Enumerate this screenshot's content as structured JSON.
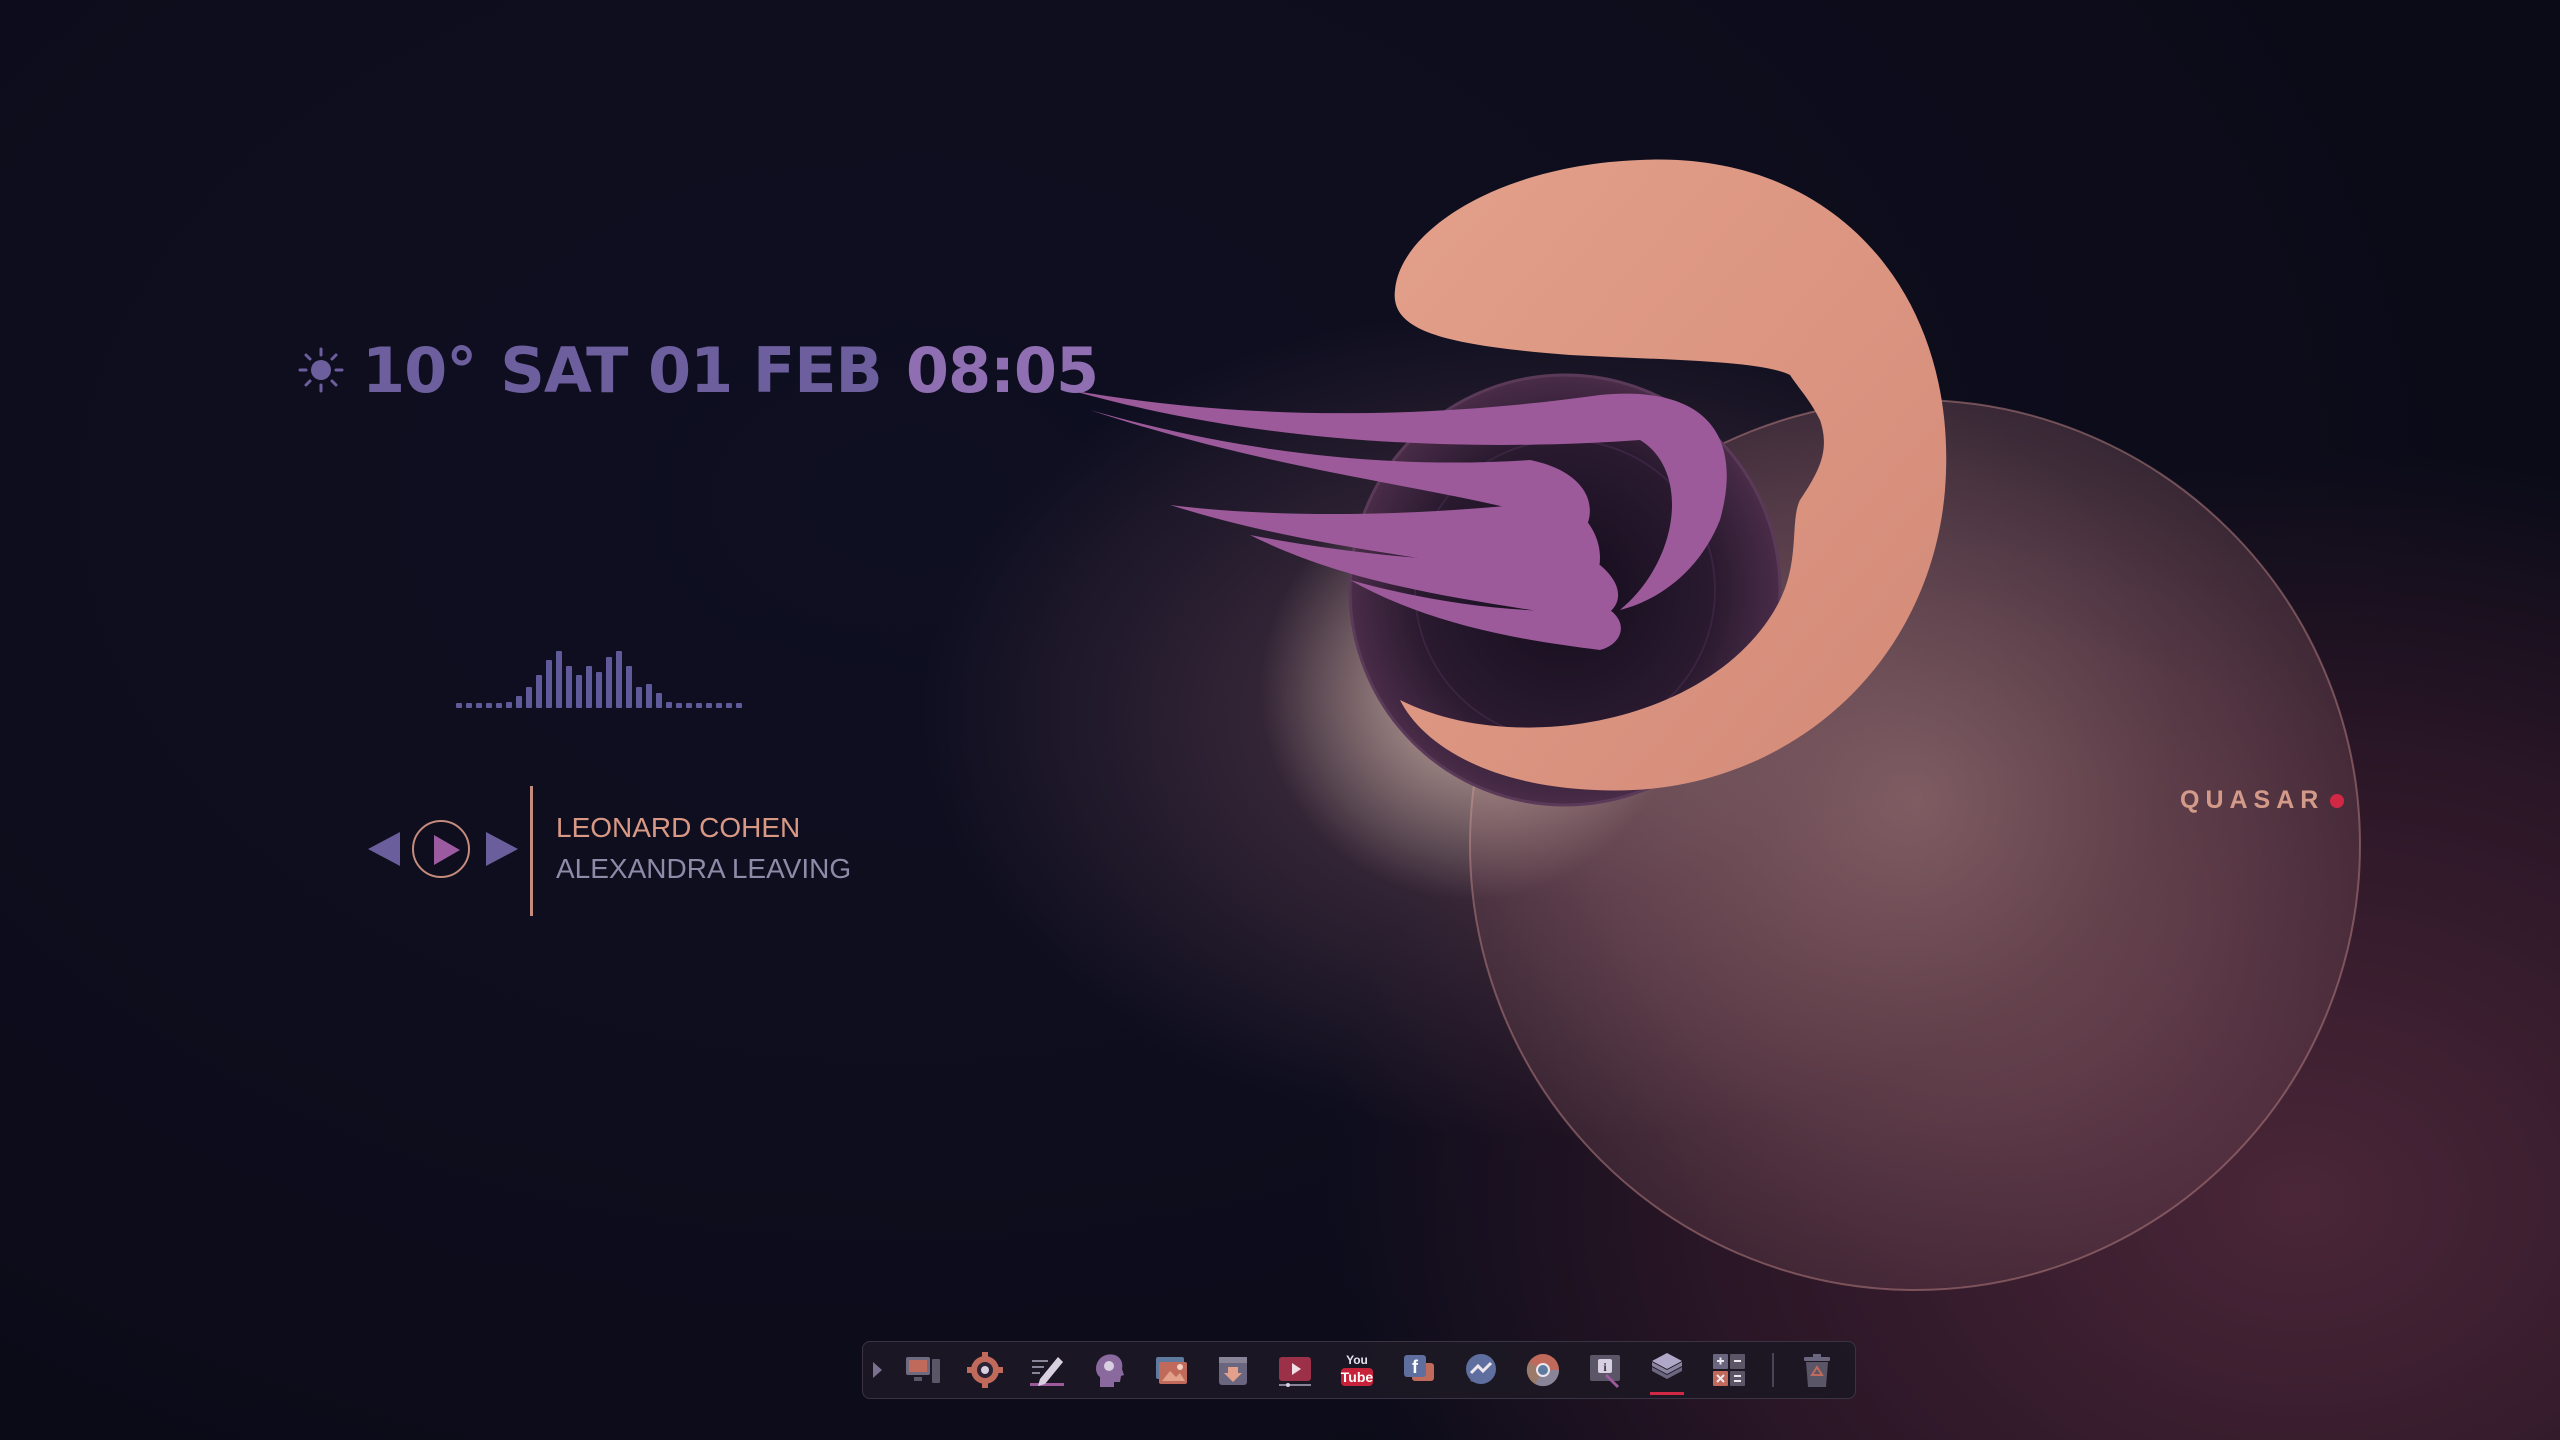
{
  "weather": {
    "icon": "sun-icon",
    "temperature": "10°"
  },
  "clock": {
    "date": "SAT 01 FEB",
    "time": "08:05"
  },
  "visualizer": {
    "levels": [
      0.05,
      0.05,
      0.05,
      0.05,
      0.05,
      0.1,
      0.2,
      0.35,
      0.55,
      0.8,
      0.95,
      0.7,
      0.55,
      0.7,
      0.6,
      0.85,
      0.95,
      0.7,
      0.35,
      0.4,
      0.25,
      0.1,
      0.05,
      0.05,
      0.05,
      0.05,
      0.05,
      0.05,
      0.05
    ]
  },
  "player": {
    "artist": "LEONARD COHEN",
    "title": "ALEXANDRA LEAVING",
    "controls": [
      "previous-icon",
      "play-icon",
      "next-icon"
    ]
  },
  "brand": {
    "name": "QUASAR"
  },
  "dock": {
    "items": [
      {
        "name": "computer",
        "icon": "computer-icon"
      },
      {
        "name": "settings",
        "icon": "gear-icon"
      },
      {
        "name": "text-editor",
        "icon": "pencil-icon"
      },
      {
        "name": "assistant",
        "icon": "head-profile-icon"
      },
      {
        "name": "photos",
        "icon": "photos-icon"
      },
      {
        "name": "downloads",
        "icon": "download-icon"
      },
      {
        "name": "media-player",
        "icon": "media-player-icon"
      },
      {
        "name": "youtube",
        "icon": "youtube-icon",
        "label_top": "You",
        "label_bottom": "Tube"
      },
      {
        "name": "facebook",
        "icon": "facebook-icon"
      },
      {
        "name": "messenger",
        "icon": "messenger-icon"
      },
      {
        "name": "chrome",
        "icon": "chrome-icon"
      },
      {
        "name": "system-info",
        "icon": "info-icon"
      },
      {
        "name": "layers",
        "icon": "layers-icon",
        "active": true
      },
      {
        "name": "calculator",
        "icon": "calculator-icon"
      },
      {
        "name": "trash",
        "icon": "recycle-bin-icon"
      }
    ]
  },
  "colors": {
    "accent": "#d02845",
    "peach": "#d99884",
    "violet": "#6d5f9e",
    "wing": "#9c5a9a"
  }
}
